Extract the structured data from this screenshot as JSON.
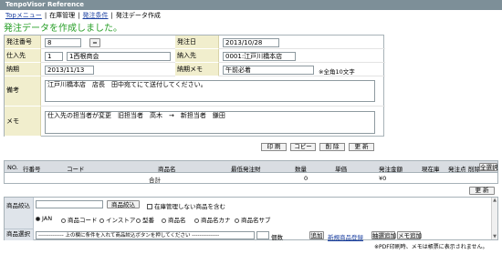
{
  "app": {
    "title": "TenpoVisor Reference"
  },
  "breadcrumb": {
    "items": [
      "Topメニュー",
      "在庫管理",
      "発注条件",
      "発注データ作成"
    ]
  },
  "message": "発注データを作成しました。",
  "form": {
    "order_no_label": "発注番号",
    "order_no_value": "8",
    "order_no_btn": "=",
    "order_date_label": "発注日",
    "order_date_value": "2013/10/28",
    "supplier_label": "仕入先",
    "supplier_code": "1",
    "supplier_name": "1西根商会",
    "delivery_label": "納入先",
    "delivery_value": "0001:江戸川橋本店",
    "due_label": "納期",
    "due_value": "2013/11/13",
    "due_memo_label": "納期メモ",
    "due_memo_value": "午前必着",
    "due_memo_note": "※全角10文字",
    "remarks_label": "備考",
    "remarks_value": "江戸川橋本店　店長　田中宛てにて送付してください。",
    "memo_label": "メモ",
    "memo_value": "仕入先の担当者が変更　旧担当者　高木　→　新担当者　鎌田"
  },
  "toolbar": {
    "print": "印 刷",
    "copy": "コピー",
    "delete": "削 除",
    "update": "更 新"
  },
  "table": {
    "headers": [
      "NO.",
      "行番号",
      "コード",
      "商品名",
      "最低発注財",
      "数量",
      "単価",
      "発注金額",
      "現在庫",
      "発注点",
      "削除",
      "全選択"
    ],
    "total_label": "合計",
    "total_qty": "0",
    "total_amount": "¥0"
  },
  "search": {
    "update_btn": "更 新",
    "narrow_label": "商品絞込",
    "narrow_btn": "商品絞込",
    "include_unmanaged": "在庫管理しない商品を含む",
    "radio_options": [
      "JAN",
      "商品コード",
      "インストア",
      "型番",
      "商品名",
      "商品名カナ",
      "商品名サブ"
    ],
    "selected_radio": "JAN",
    "select_label": "商品選択",
    "select_placeholder": "-------------- 上の欄に条件を入れて商品絞込ボタンを押してください ---------------",
    "qty_suffix": "個数",
    "add_btn": "追加",
    "new_product_link": "新規商品登録",
    "cart_add_btn": "抽選追加",
    "memo_add_btn": "メモ追加",
    "pdf_note": "※PDF印刷時、メモは帳票に表示されません。"
  }
}
